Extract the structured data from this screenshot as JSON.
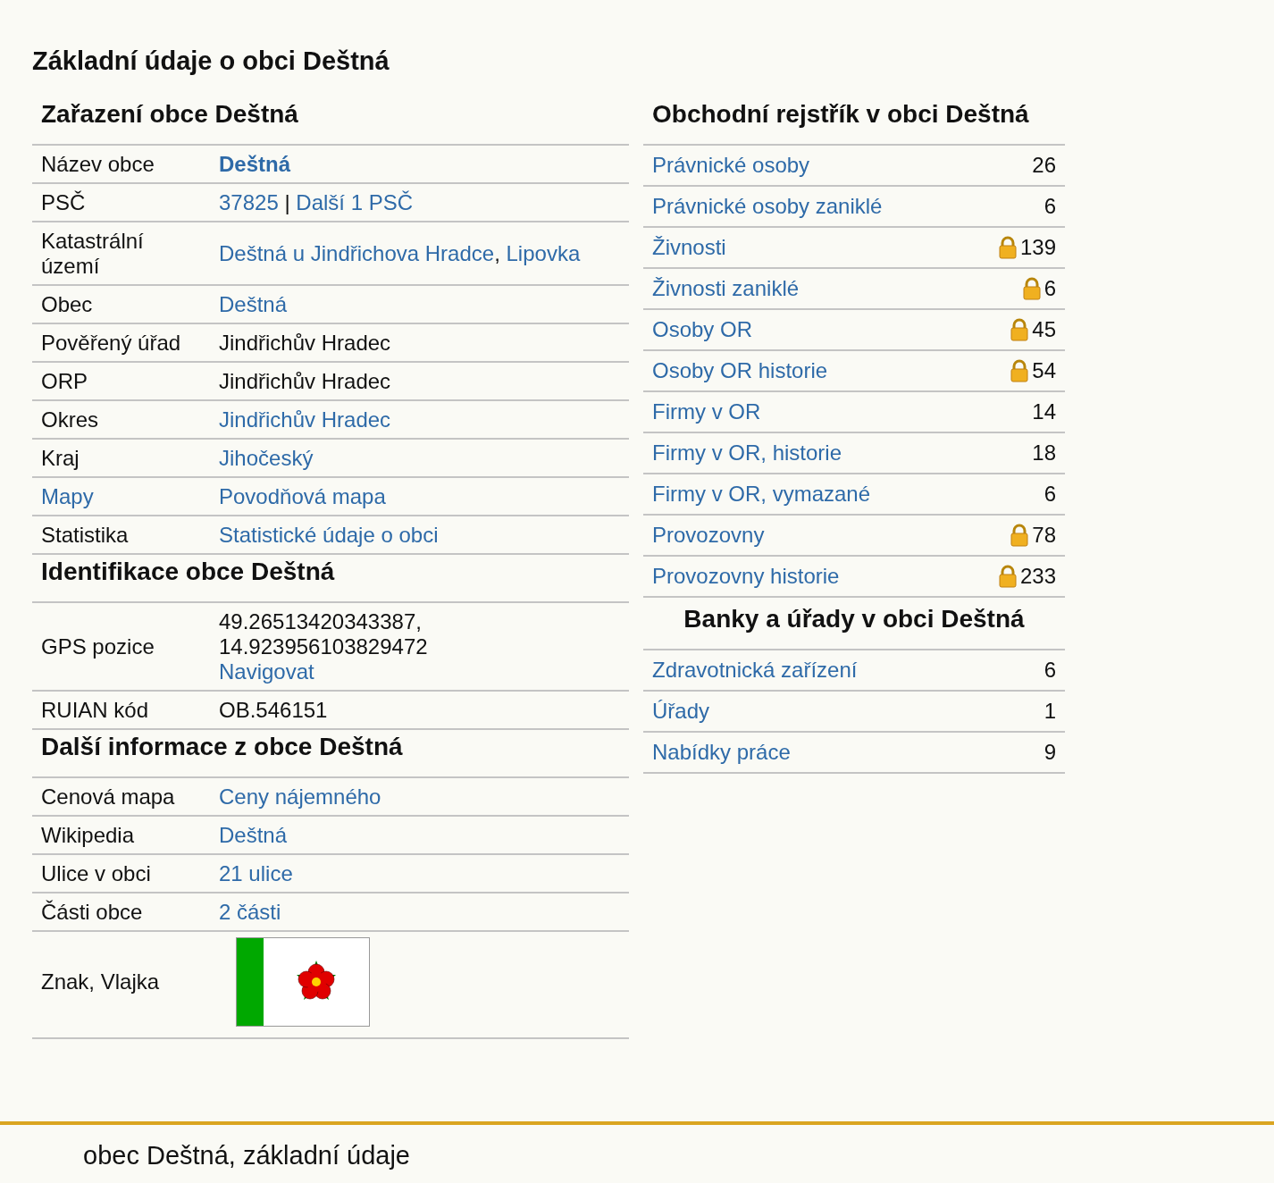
{
  "title": "Základní údaje o obci Deštná",
  "left_sections": [
    {
      "title": "Zařazení obce Deštná",
      "rows": [
        {
          "label": "Název obce",
          "label_link": false,
          "kind": "text",
          "lines": [
            [
              {
                "text": "Deštná",
                "kind": "link_bold"
              }
            ]
          ]
        },
        {
          "label": "PSČ",
          "label_link": false,
          "kind": "text",
          "lines": [
            [
              {
                "text": "37825",
                "kind": "link"
              },
              {
                "text": " | ",
                "kind": "text"
              },
              {
                "text": "Další 1 PSČ",
                "kind": "link"
              }
            ]
          ]
        },
        {
          "label": "Katastrální území",
          "label_link": false,
          "kind": "text",
          "lines": [
            [
              {
                "text": "Deštná u Jindřichova Hradce",
                "kind": "link"
              },
              {
                "text": ", ",
                "kind": "text"
              },
              {
                "text": "Lipovka",
                "kind": "link"
              }
            ]
          ]
        },
        {
          "label": "Obec",
          "label_link": false,
          "kind": "text",
          "lines": [
            [
              {
                "text": "Deštná",
                "kind": "link"
              }
            ]
          ]
        },
        {
          "label": "Pověřený úřad",
          "label_link": false,
          "kind": "text",
          "lines": [
            [
              {
                "text": "Jindřichův Hradec",
                "kind": "text"
              }
            ]
          ]
        },
        {
          "label": "ORP",
          "label_link": false,
          "kind": "text",
          "lines": [
            [
              {
                "text": "Jindřichův Hradec",
                "kind": "text"
              }
            ]
          ]
        },
        {
          "label": "Okres",
          "label_link": false,
          "kind": "text",
          "lines": [
            [
              {
                "text": "Jindřichův Hradec",
                "kind": "link"
              }
            ]
          ]
        },
        {
          "label": "Kraj",
          "label_link": false,
          "kind": "text",
          "lines": [
            [
              {
                "text": "Jihočeský",
                "kind": "link"
              }
            ]
          ]
        },
        {
          "label": "Mapy",
          "label_link": true,
          "kind": "text",
          "lines": [
            [
              {
                "text": "Povodňová mapa",
                "kind": "link"
              }
            ]
          ]
        },
        {
          "label": "Statistika",
          "label_link": false,
          "kind": "text",
          "lines": [
            [
              {
                "text": "Statistické údaje o obci",
                "kind": "link"
              }
            ]
          ]
        }
      ]
    },
    {
      "title": "Identifikace obce Deštná",
      "rows": [
        {
          "label": "GPS pozice",
          "label_link": false,
          "kind": "text",
          "lines": [
            [
              {
                "text": "49.26513420343387,",
                "kind": "text"
              }
            ],
            [
              {
                "text": "14.923956103829472",
                "kind": "text"
              }
            ],
            [
              {
                "text": "Navigovat",
                "kind": "link"
              }
            ]
          ]
        },
        {
          "label": "RUIAN kód",
          "label_link": false,
          "kind": "text",
          "lines": [
            [
              {
                "text": "OB.546151",
                "kind": "text"
              }
            ]
          ]
        }
      ]
    },
    {
      "title": "Další informace z obce Deštná",
      "rows": [
        {
          "label": "Cenová mapa",
          "label_link": false,
          "kind": "text",
          "lines": [
            [
              {
                "text": "Ceny nájemného",
                "kind": "link"
              }
            ]
          ]
        },
        {
          "label": "Wikipedia",
          "label_link": false,
          "kind": "text",
          "lines": [
            [
              {
                "text": "Deštná",
                "kind": "link"
              }
            ]
          ]
        },
        {
          "label": "Ulice v obci",
          "label_link": false,
          "kind": "text",
          "lines": [
            [
              {
                "text": "21 ulice",
                "kind": "link"
              }
            ]
          ]
        },
        {
          "label": "Části obce",
          "label_link": false,
          "kind": "text",
          "lines": [
            [
              {
                "text": "2 části",
                "kind": "link"
              }
            ]
          ]
        },
        {
          "label": "Znak, Vlajka",
          "label_link": false,
          "kind": "flag",
          "lines": []
        }
      ]
    }
  ],
  "right_sections": [
    {
      "title": "Obchodní rejstřík v obci Deštná",
      "centered": false,
      "rows": [
        {
          "label": "Právnické osoby",
          "count": "26",
          "locked": false
        },
        {
          "label": "Právnické osoby zaniklé",
          "count": "6",
          "locked": false
        },
        {
          "label": "Živnosti",
          "count": "139",
          "locked": true
        },
        {
          "label": "Živnosti zaniklé",
          "count": "6",
          "locked": true
        },
        {
          "label": "Osoby OR",
          "count": "45",
          "locked": true
        },
        {
          "label": "Osoby OR historie",
          "count": "54",
          "locked": true
        },
        {
          "label": "Firmy v OR",
          "count": "14",
          "locked": false
        },
        {
          "label": "Firmy v OR, historie",
          "count": "18",
          "locked": false
        },
        {
          "label": "Firmy v OR, vymazané",
          "count": "6",
          "locked": false
        },
        {
          "label": "Provozovny",
          "count": "78",
          "locked": true
        },
        {
          "label": "Provozovny historie",
          "count": "233",
          "locked": true
        }
      ]
    },
    {
      "title": "Banky a úřady v obci Deštná",
      "centered": true,
      "rows": [
        {
          "label": "Zdravotnická zařízení",
          "count": "6",
          "locked": false
        },
        {
          "label": "Úřady",
          "count": "1",
          "locked": false
        },
        {
          "label": "Nabídky práce",
          "count": "9",
          "locked": false
        }
      ]
    }
  ],
  "footer": "obec Deštná, základní údaje"
}
